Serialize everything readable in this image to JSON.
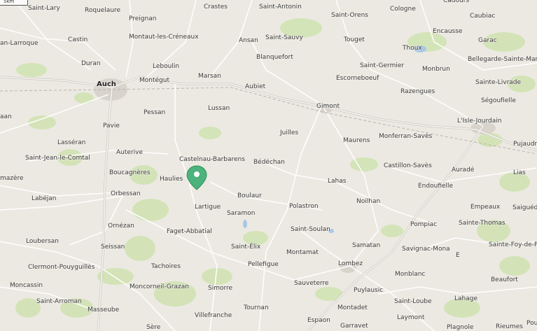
{
  "map": {
    "scale_label": "5km",
    "marker": {
      "color": "#4bb37b"
    },
    "places": [
      {
        "id": "saint-lary",
        "name": "Saint-Lary"
      },
      {
        "id": "roquelaure",
        "name": "Roquelaure"
      },
      {
        "id": "crastes",
        "name": "Crastes"
      },
      {
        "id": "saint-antonin",
        "name": "Saint-Antonin"
      },
      {
        "id": "saint-orens",
        "name": "Saint-Orens"
      },
      {
        "id": "cologne",
        "name": "Cologne"
      },
      {
        "id": "caubiac",
        "name": "Caubiac"
      },
      {
        "id": "cadours",
        "name": "Cadours"
      },
      {
        "id": "preignan",
        "name": "Preignan"
      },
      {
        "id": "montaut-les-creneaux",
        "name": "Montaut-les-Créneaux"
      },
      {
        "id": "castin",
        "name": "Castin"
      },
      {
        "id": "an-larroque",
        "name": "an-Larroque"
      },
      {
        "id": "ansan",
        "name": "Ansan"
      },
      {
        "id": "saint-sauvy",
        "name": "Saint-Sauvy"
      },
      {
        "id": "touget",
        "name": "Touget"
      },
      {
        "id": "encausse",
        "name": "Encausse"
      },
      {
        "id": "garac",
        "name": "Garac"
      },
      {
        "id": "thoux",
        "name": "Thoux"
      },
      {
        "id": "bellegarde",
        "name": "Bellegarde-Sainte-Mari"
      },
      {
        "id": "blanquefort",
        "name": "Blanquefort"
      },
      {
        "id": "duran",
        "name": "Duran"
      },
      {
        "id": "leboulin",
        "name": "Leboulin"
      },
      {
        "id": "saint-germier",
        "name": "Saint-Germier"
      },
      {
        "id": "monbrun",
        "name": "Monbrun"
      },
      {
        "id": "auch",
        "name": "Auch"
      },
      {
        "id": "montegut",
        "name": "Montégut"
      },
      {
        "id": "marsan",
        "name": "Marsan"
      },
      {
        "id": "escorneboeuf",
        "name": "Escorneboeuf"
      },
      {
        "id": "sainte-livrade",
        "name": "Sainte-Livrade"
      },
      {
        "id": "aubiet",
        "name": "Aubiet"
      },
      {
        "id": "razengues",
        "name": "Razengues"
      },
      {
        "id": "segoufielle",
        "name": "Ségoufielle"
      },
      {
        "id": "gimont",
        "name": "Gimont"
      },
      {
        "id": "lussan",
        "name": "Lussan"
      },
      {
        "id": "pessan",
        "name": "Pessan"
      },
      {
        "id": "lisle-jourdain",
        "name": "L'Isle-Jourdain"
      },
      {
        "id": "pavie",
        "name": "Pavie"
      },
      {
        "id": "juilles",
        "name": "Juilles"
      },
      {
        "id": "monferran-saves",
        "name": "Monferran-Savès"
      },
      {
        "id": "lasseran",
        "name": "Lasséran"
      },
      {
        "id": "maurens",
        "name": "Maurens"
      },
      {
        "id": "pujaudr",
        "name": "Pujaudr"
      },
      {
        "id": "auterive",
        "name": "Auterive"
      },
      {
        "id": "saint-jean-le-comtal",
        "name": "Saint-Jean-le-Comtal"
      },
      {
        "id": "castelnau-barbarens",
        "name": "Castelnau-Barbarens"
      },
      {
        "id": "bedechan",
        "name": "Bédéchan"
      },
      {
        "id": "castillon-saves",
        "name": "Castillon-Savès"
      },
      {
        "id": "aurade",
        "name": "Auradé"
      },
      {
        "id": "bougagneres",
        "name": "Boucagnères"
      },
      {
        "id": "lias",
        "name": "Lias"
      },
      {
        "id": "mazere",
        "name": "mazère"
      },
      {
        "id": "haulies",
        "name": "Haulies"
      },
      {
        "id": "lahas",
        "name": "Lahas"
      },
      {
        "id": "endoufielle",
        "name": "Endoufielle"
      },
      {
        "id": "orbessan",
        "name": "Orbessan"
      },
      {
        "id": "boulaur",
        "name": "Boulaur"
      },
      {
        "id": "labejan",
        "name": "Labéjan"
      },
      {
        "id": "noilhan",
        "name": "Noilhan"
      },
      {
        "id": "lartigue",
        "name": "Lartigue"
      },
      {
        "id": "polastron",
        "name": "Polastron"
      },
      {
        "id": "empeaux",
        "name": "Empeaux"
      },
      {
        "id": "saiguede",
        "name": "Saiguéd"
      },
      {
        "id": "saramon",
        "name": "Saramon"
      },
      {
        "id": "ornezan",
        "name": "Ornézan"
      },
      {
        "id": "pompiac",
        "name": "Pompiac"
      },
      {
        "id": "sainte-thomas",
        "name": "Sainte-Thomas"
      },
      {
        "id": "faget-abbatial",
        "name": "Faget-Abbatial"
      },
      {
        "id": "saint-soulan",
        "name": "Saint-Soulan"
      },
      {
        "id": "loubersan",
        "name": "Loubersan"
      },
      {
        "id": "sainte-foy-de-p",
        "name": "Sainte-Foy-de-P"
      },
      {
        "id": "samatan",
        "name": "Samatan"
      },
      {
        "id": "seissan",
        "name": "Seissan"
      },
      {
        "id": "saint-elix",
        "name": "Saint-Élix"
      },
      {
        "id": "savignac-mona",
        "name": "Savignac-Mona"
      },
      {
        "id": "montamat",
        "name": "Montamat"
      },
      {
        "id": "e",
        "name": "E"
      },
      {
        "id": "tachoires",
        "name": "Tachoires"
      },
      {
        "id": "pellefigue",
        "name": "Pellefigue"
      },
      {
        "id": "lombez",
        "name": "Lombez"
      },
      {
        "id": "clermont-pouyguilles",
        "name": "Clermont-Pouyguillès"
      },
      {
        "id": "monblanc",
        "name": "Monblanc"
      },
      {
        "id": "beaufort",
        "name": "Beaufort"
      },
      {
        "id": "moncassin",
        "name": "Moncassin"
      },
      {
        "id": "moncorneil-grazan",
        "name": "Moncorneil-Grazan"
      },
      {
        "id": "sauveterre",
        "name": "Sauveterre"
      },
      {
        "id": "simorre",
        "name": "Simorre"
      },
      {
        "id": "puylausic",
        "name": "Puylausic"
      },
      {
        "id": "lahage",
        "name": "Lahage"
      },
      {
        "id": "saint-arroman",
        "name": "Saint-Arroman"
      },
      {
        "id": "saint-loube",
        "name": "Saint-Loube"
      },
      {
        "id": "tournan",
        "name": "Tournan"
      },
      {
        "id": "montadet",
        "name": "Montadet"
      },
      {
        "id": "masseube",
        "name": "Masseube"
      },
      {
        "id": "villefranche",
        "name": "Villefranche"
      },
      {
        "id": "laymont",
        "name": "Laymont"
      },
      {
        "id": "espaon",
        "name": "Espaon"
      },
      {
        "id": "garravet",
        "name": "Garravet"
      },
      {
        "id": "sere",
        "name": "Sère"
      },
      {
        "id": "plagnole",
        "name": "Plagnole"
      },
      {
        "id": "rieumes",
        "name": "Rieumes"
      },
      {
        "id": "pou",
        "name": "Pou"
      },
      {
        "id": "aan",
        "name": "aan"
      }
    ]
  }
}
